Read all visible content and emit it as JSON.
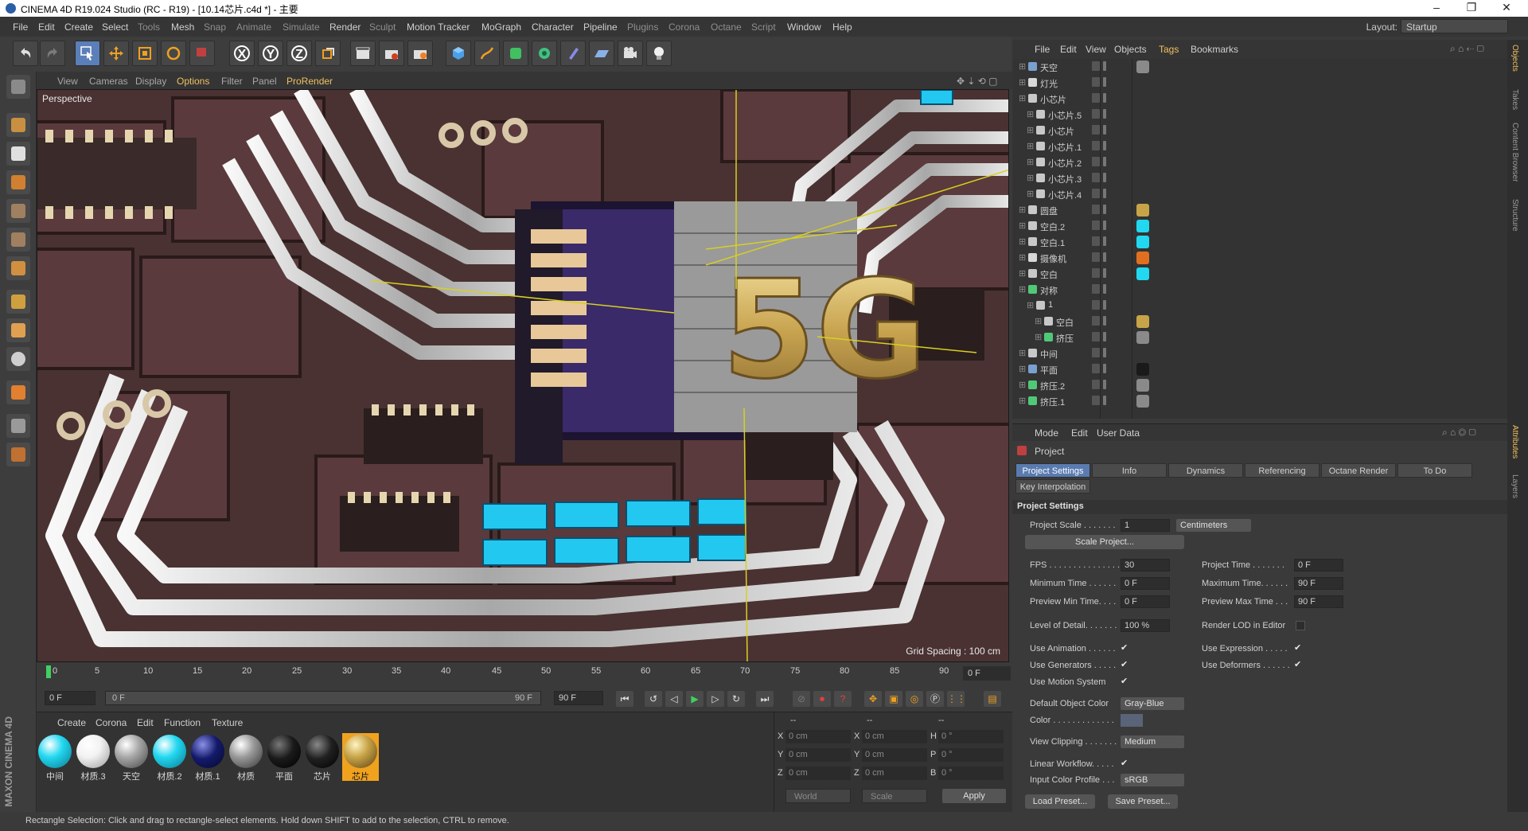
{
  "window": {
    "title": "CINEMA 4D R19.024 Studio (RC - R19) - [10.14芯片.c4d *] - 主要",
    "controls": [
      "–",
      "❐",
      "✕"
    ]
  },
  "menubar": {
    "items": [
      "File",
      "Edit",
      "Create",
      "Select",
      "Tools",
      "Mesh",
      "Snap",
      "Animate",
      "Simulate",
      "Render",
      "Sculpt",
      "Motion Tracker",
      "MoGraph",
      "Character",
      "Pipeline",
      "Plugins",
      "Corona",
      "Octane",
      "Script",
      "Window",
      "Help"
    ],
    "layout_label": "Layout:",
    "layout_value": "Startup"
  },
  "toolbar": {
    "axis_buttons": [
      "X",
      "Y",
      "Z"
    ]
  },
  "viewport": {
    "menu": [
      "View",
      "Cameras",
      "Display",
      "Options",
      "Filter",
      "Panel",
      "ProRender"
    ],
    "camera_label": "Perspective",
    "grid_spacing": "Grid Spacing : 100 cm",
    "hero_text": "5G"
  },
  "timeline": {
    "ticks": [
      "0",
      "5",
      "10",
      "15",
      "20",
      "25",
      "30",
      "35",
      "40",
      "45",
      "50",
      "55",
      "60",
      "65",
      "70",
      "75",
      "80",
      "85",
      "90"
    ],
    "current_frame": "0 F",
    "start_field": "0 F",
    "range_start": "0 F",
    "range_end": "90 F",
    "end_field": "90 F"
  },
  "material_manager": {
    "menu": [
      "Create",
      "Corona",
      "Edit",
      "Function",
      "Texture"
    ],
    "materials": [
      {
        "name": "中间",
        "color": "#22d8f0"
      },
      {
        "name": "材质.3",
        "color": "#f2f2f2"
      },
      {
        "name": "天空",
        "color": "#a8a8a8"
      },
      {
        "name": "材质.2",
        "color": "#22d8f0"
      },
      {
        "name": "材质.1",
        "color": "#141a6a"
      },
      {
        "name": "材质",
        "color": "#9a9a9a"
      },
      {
        "name": "平面",
        "color": "#1a1a1a"
      },
      {
        "name": "芯片",
        "color": "#202020"
      },
      {
        "name": "芯片",
        "color": "#c8a448"
      }
    ]
  },
  "coordinates": {
    "headers": [
      "--",
      "--",
      "--"
    ],
    "rows": [
      {
        "a": "X",
        "av": "0 cm",
        "b": "X",
        "bv": "0 cm",
        "c": "H",
        "cv": "0 °"
      },
      {
        "a": "Y",
        "av": "0 cm",
        "b": "Y",
        "bv": "0 cm",
        "c": "P",
        "cv": "0 °"
      },
      {
        "a": "Z",
        "av": "0 cm",
        "b": "Z",
        "bv": "0 cm",
        "c": "B",
        "cv": "0 °"
      }
    ],
    "mode1": "World",
    "mode2": "Scale",
    "apply": "Apply"
  },
  "status": "Rectangle Selection: Click and drag to rectangle-select elements. Hold down SHIFT to add to the selection, CTRL to remove.",
  "object_manager": {
    "menu": [
      "File",
      "Edit",
      "View",
      "Objects",
      "Tags",
      "Bookmarks"
    ],
    "objects": [
      {
        "name": "天空",
        "indent": 0,
        "icon": "#7aa0d0",
        "tag": "#8a8a8a"
      },
      {
        "name": "灯光",
        "indent": 0,
        "icon": "#d8d8d8",
        "tag": ""
      },
      {
        "name": "小芯片",
        "indent": 0,
        "icon": "#c8c8c8",
        "tag": ""
      },
      {
        "name": "小芯片.5",
        "indent": 1,
        "icon": "#c8c8c8",
        "tag": ""
      },
      {
        "name": "小芯片",
        "indent": 1,
        "icon": "#c8c8c8",
        "tag": ""
      },
      {
        "name": "小芯片.1",
        "indent": 1,
        "icon": "#c8c8c8",
        "tag": ""
      },
      {
        "name": "小芯片.2",
        "indent": 1,
        "icon": "#c8c8c8",
        "tag": ""
      },
      {
        "name": "小芯片.3",
        "indent": 1,
        "icon": "#c8c8c8",
        "tag": ""
      },
      {
        "name": "小芯片.4",
        "indent": 1,
        "icon": "#c8c8c8",
        "tag": ""
      },
      {
        "name": "圆盘",
        "indent": 0,
        "icon": "#c8c8c8",
        "tag": "#c8a448"
      },
      {
        "name": "空白.2",
        "indent": 0,
        "icon": "#c8c8c8",
        "tag": "#22d8f0"
      },
      {
        "name": "空白.1",
        "indent": 0,
        "icon": "#c8c8c8",
        "tag": "#22d8f0"
      },
      {
        "name": "摄像机",
        "indent": 0,
        "icon": "#d8d8d8",
        "tag": "#e07020"
      },
      {
        "name": "空白",
        "indent": 0,
        "icon": "#c8c8c8",
        "tag": "#22d8f0"
      },
      {
        "name": "对称",
        "indent": 0,
        "icon": "#50c878",
        "tag": ""
      },
      {
        "name": "1",
        "indent": 1,
        "icon": "#c8c8c8",
        "tag": ""
      },
      {
        "name": "空白",
        "indent": 2,
        "icon": "#c8c8c8",
        "tag": "#c8a448"
      },
      {
        "name": "挤压",
        "indent": 2,
        "icon": "#50c878",
        "tag": "#8a8a8a"
      },
      {
        "name": "中间",
        "indent": 0,
        "icon": "#c8c8c8",
        "tag": ""
      },
      {
        "name": "平面",
        "indent": 0,
        "icon": "#7aa0d0",
        "tag": "#1a1a1a"
      },
      {
        "name": "挤压.2",
        "indent": 0,
        "icon": "#50c878",
        "tag": "#8a8a8a"
      },
      {
        "name": "挤压.1",
        "indent": 0,
        "icon": "#50c878",
        "tag": "#8a8a8a"
      }
    ]
  },
  "attribute_manager": {
    "menu": [
      "Mode",
      "Edit",
      "User Data"
    ],
    "object_title": "Project",
    "tabs": [
      "Project Settings",
      "Info",
      "Dynamics",
      "Referencing",
      "Octane Render",
      "To Do"
    ],
    "tab2": "Key Interpolation",
    "section": "Project Settings",
    "project_scale_label": "Project Scale . . . . . . .",
    "project_scale_value": "1",
    "project_scale_unit": "Centimeters",
    "scale_project_btn": "Scale Project...",
    "fps_label": "FPS . . . . . . . . . . . . . . .",
    "fps_value": "30",
    "project_time_label": "Project Time . . . . . . .",
    "project_time_value": "0 F",
    "min_time_label": "Minimum Time . . . . . .",
    "min_time_value": "0 F",
    "max_time_label": "Maximum Time. . . . . .",
    "max_time_value": "90 F",
    "prev_min_label": "Preview Min Time. . . .",
    "prev_min_value": "0 F",
    "prev_max_label": "Preview Max Time . . .",
    "prev_max_value": "90 F",
    "lod_label": "Level of Detail. . . . . . .",
    "lod_value": "100 %",
    "render_lod_label": "Render LOD in Editor",
    "use_anim_label": "Use Animation . . . . . .",
    "use_expr_label": "Use Expression . . . . .",
    "use_gen_label": "Use Generators . . . . .",
    "use_def_label": "Use Deformers . . . . . .",
    "use_motion_label": "Use Motion System",
    "default_color_label": "Default Object Color",
    "default_color_value": "Gray-Blue",
    "color_label": "Color . . . . . . . . . . . . .",
    "view_clip_label": "View Clipping . . . . . . .",
    "view_clip_value": "Medium",
    "linear_label": "Linear Workflow. . . . .",
    "input_profile_label": "Input Color Profile . . .",
    "input_profile_value": "sRGB",
    "load_preset": "Load Preset...",
    "save_preset": "Save Preset..."
  },
  "side_tabs": [
    "Objects",
    "Takes",
    "Content Browser",
    "Structure",
    "Attributes",
    "Layers"
  ],
  "branding": "MAXON CINEMA 4D"
}
